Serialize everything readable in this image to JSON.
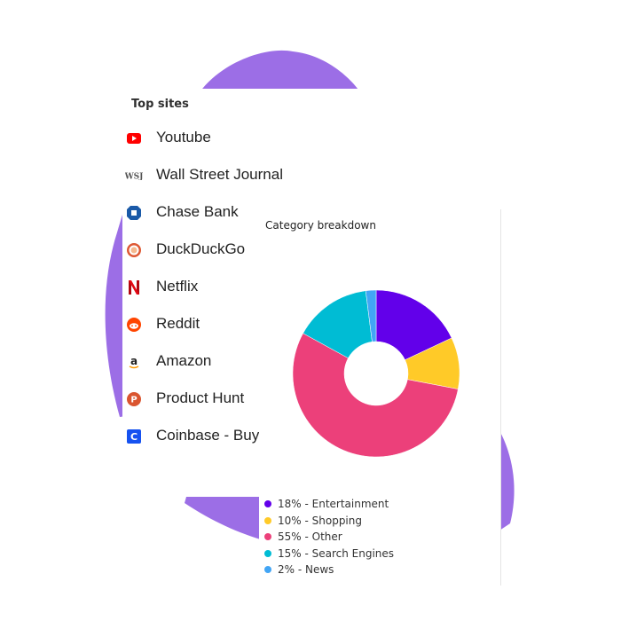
{
  "top_sites": {
    "title": "Top sites",
    "items": [
      {
        "label": "Youtube",
        "icon": "youtube-icon",
        "color": "#ff0000"
      },
      {
        "label": "Wall Street Journal",
        "icon": "wsj-icon",
        "color": "#555555"
      },
      {
        "label": "Chase Bank",
        "icon": "chase-icon",
        "color": "#1a5aa8"
      },
      {
        "label": "DuckDuckGo",
        "icon": "duckduckgo-icon",
        "color": "#de5833"
      },
      {
        "label": "Netflix",
        "icon": "netflix-icon",
        "color": "#e50914"
      },
      {
        "label": "Reddit",
        "icon": "reddit-icon",
        "color": "#ff4500"
      },
      {
        "label": "Amazon",
        "icon": "amazon-icon",
        "color": "#ff9900"
      },
      {
        "label": "Product Hunt",
        "icon": "producthunt-icon",
        "color": "#da552f"
      },
      {
        "label": "Coinbase - Buy",
        "icon": "coinbase-icon",
        "color": "#1652f0"
      }
    ]
  },
  "chart_data": {
    "type": "pie",
    "variant": "donut",
    "title": "Category breakdown",
    "categories": [
      "Entertainment",
      "Shopping",
      "Other",
      "Search Engines",
      "News"
    ],
    "values": [
      18,
      10,
      55,
      15,
      2
    ],
    "legend_labels": [
      "18% - Entertainment",
      "10% - Shopping",
      "55% - Other",
      "15% - Search Engines",
      "2% - News"
    ],
    "colors": [
      "#6200ea",
      "#ffca28",
      "#ec407a",
      "#00bcd4",
      "#42a5f5"
    ],
    "legend_position": "bottom"
  },
  "background": {
    "blob_color": "#9c6ee6"
  }
}
